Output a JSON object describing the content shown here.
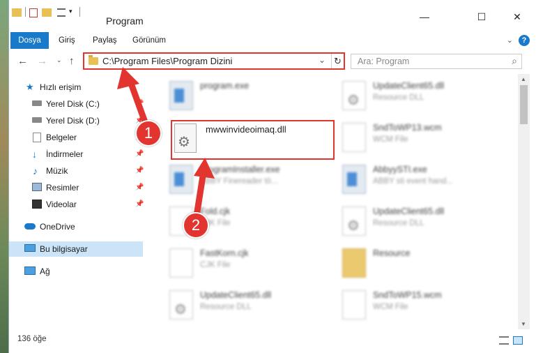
{
  "window": {
    "title": "Program",
    "minimize": "—",
    "maximize": "☐",
    "close": "✕"
  },
  "ribbon": {
    "tabs": [
      "Dosya",
      "Giriş",
      "Paylaş",
      "Görünüm"
    ],
    "help": "?"
  },
  "nav": {
    "address": "C:\\Program Files\\Program Dizini",
    "search_placeholder": "Ara: Program"
  },
  "sidebar": {
    "items": [
      {
        "label": "Hızlı erişim",
        "icon": "star-icon"
      },
      {
        "label": "Yerel Disk (C:)",
        "icon": "drive-icon"
      },
      {
        "label": "Yerel Disk (D:)",
        "icon": "drive-icon"
      },
      {
        "label": "Belgeler",
        "icon": "documents-icon"
      },
      {
        "label": "İndirmeler",
        "icon": "download-icon"
      },
      {
        "label": "Müzik",
        "icon": "music-icon"
      },
      {
        "label": "Resimler",
        "icon": "pictures-icon"
      },
      {
        "label": "Videolar",
        "icon": "videos-icon"
      },
      {
        "label": "OneDrive",
        "icon": "cloud-icon"
      },
      {
        "label": "Bu bilgisayar",
        "icon": "computer-icon"
      },
      {
        "label": "Ağ",
        "icon": "network-icon"
      }
    ]
  },
  "files": [
    {
      "name": "program.exe",
      "type": ""
    },
    {
      "name": "UpdateClient65.dll",
      "type": "Resource DLL"
    },
    {
      "name": "SndToWP13.wcm",
      "type": "WCM File"
    },
    {
      "name": "ProgramInstaller.exe",
      "type": "ABBY Finereader tö..."
    },
    {
      "name": "AbbyySTI.exe",
      "type": "ABBY sti event hand..."
    },
    {
      "name": "Fold.cjk",
      "type": "CJK File"
    },
    {
      "name": "UpdateClient65.dll",
      "type": "Resource DLL"
    },
    {
      "name": "FastKorn.cjk",
      "type": "CJK File"
    },
    {
      "name": "Resource",
      "type": ""
    },
    {
      "name": "UpdateClient65.dll",
      "type": "Resource DLL"
    },
    {
      "name": "SndToWP15.wcm",
      "type": "WCM File"
    }
  ],
  "highlighted_file": "mwwinvideoimaq.dll",
  "status": {
    "count": "136 öğe"
  },
  "callouts": [
    "1",
    "2"
  ],
  "colors": {
    "accent": "#1979ca",
    "highlight": "#e2352f",
    "selection": "#cce4f7"
  }
}
